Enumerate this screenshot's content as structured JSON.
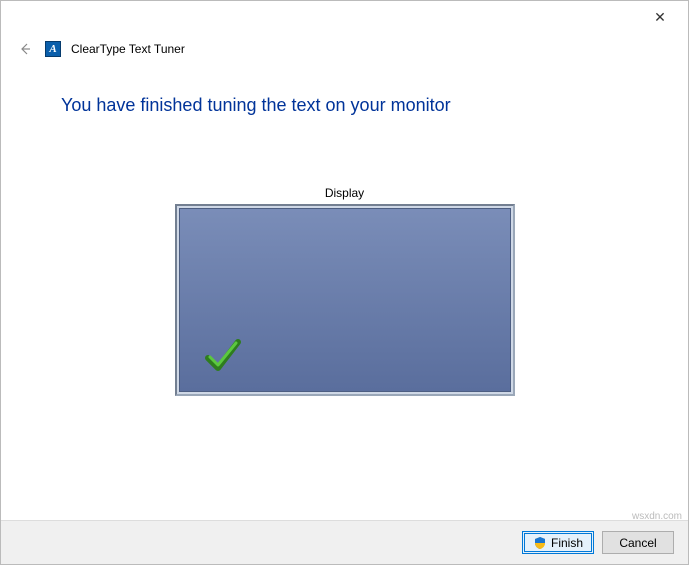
{
  "window": {
    "close_symbol": "✕"
  },
  "header": {
    "back_symbol": "←",
    "app_icon_letter": "A",
    "app_title": "ClearType Text Tuner"
  },
  "content": {
    "heading": "You have finished tuning the text on your monitor",
    "display_label": "Display"
  },
  "footer": {
    "finish_label": "Finish",
    "cancel_label": "Cancel"
  },
  "watermark": "wsxdn.com",
  "colors": {
    "heading_color": "#003399",
    "monitor_top": "#7a8db8",
    "monitor_bottom": "#5a6e9d",
    "checkmark_green": "#3fa62f"
  }
}
